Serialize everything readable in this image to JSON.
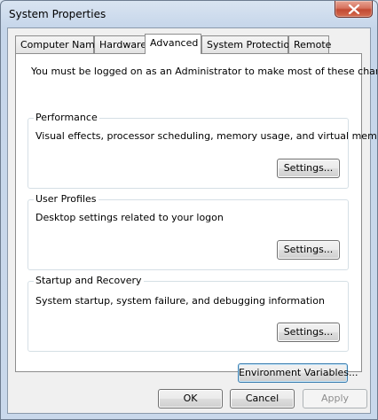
{
  "window": {
    "title": "System Properties"
  },
  "tabs": [
    {
      "label": "Computer Name"
    },
    {
      "label": "Hardware"
    },
    {
      "label": "Advanced"
    },
    {
      "label": "System Protection"
    },
    {
      "label": "Remote"
    }
  ],
  "active_tab": "Advanced",
  "advanced": {
    "intro": "You must be logged on as an Administrator to make most of these changes.",
    "performance": {
      "title": "Performance",
      "description": "Visual effects, processor scheduling, memory usage, and virtual memory",
      "button": "Settings..."
    },
    "user_profiles": {
      "title": "User Profiles",
      "description": "Desktop settings related to your logon",
      "button": "Settings..."
    },
    "startup_recovery": {
      "title": "Startup and Recovery",
      "description": "System startup, system failure, and debugging information",
      "button": "Settings..."
    },
    "environment_button": "Environment Variables..."
  },
  "footer": {
    "ok": "OK",
    "cancel": "Cancel",
    "apply": "Apply"
  },
  "icons": {
    "close": "close-icon"
  }
}
